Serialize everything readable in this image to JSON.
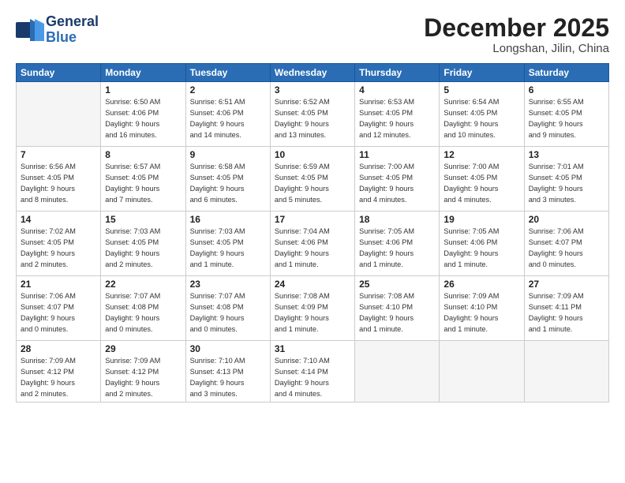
{
  "logo": {
    "line1": "General",
    "line2": "Blue"
  },
  "header": {
    "month": "December 2025",
    "location": "Longshan, Jilin, China"
  },
  "weekdays": [
    "Sunday",
    "Monday",
    "Tuesday",
    "Wednesday",
    "Thursday",
    "Friday",
    "Saturday"
  ],
  "weeks": [
    [
      {
        "day": "",
        "info": ""
      },
      {
        "day": "1",
        "info": "Sunrise: 6:50 AM\nSunset: 4:06 PM\nDaylight: 9 hours\nand 16 minutes."
      },
      {
        "day": "2",
        "info": "Sunrise: 6:51 AM\nSunset: 4:06 PM\nDaylight: 9 hours\nand 14 minutes."
      },
      {
        "day": "3",
        "info": "Sunrise: 6:52 AM\nSunset: 4:05 PM\nDaylight: 9 hours\nand 13 minutes."
      },
      {
        "day": "4",
        "info": "Sunrise: 6:53 AM\nSunset: 4:05 PM\nDaylight: 9 hours\nand 12 minutes."
      },
      {
        "day": "5",
        "info": "Sunrise: 6:54 AM\nSunset: 4:05 PM\nDaylight: 9 hours\nand 10 minutes."
      },
      {
        "day": "6",
        "info": "Sunrise: 6:55 AM\nSunset: 4:05 PM\nDaylight: 9 hours\nand 9 minutes."
      }
    ],
    [
      {
        "day": "7",
        "info": "Sunrise: 6:56 AM\nSunset: 4:05 PM\nDaylight: 9 hours\nand 8 minutes."
      },
      {
        "day": "8",
        "info": "Sunrise: 6:57 AM\nSunset: 4:05 PM\nDaylight: 9 hours\nand 7 minutes."
      },
      {
        "day": "9",
        "info": "Sunrise: 6:58 AM\nSunset: 4:05 PM\nDaylight: 9 hours\nand 6 minutes."
      },
      {
        "day": "10",
        "info": "Sunrise: 6:59 AM\nSunset: 4:05 PM\nDaylight: 9 hours\nand 5 minutes."
      },
      {
        "day": "11",
        "info": "Sunrise: 7:00 AM\nSunset: 4:05 PM\nDaylight: 9 hours\nand 4 minutes."
      },
      {
        "day": "12",
        "info": "Sunrise: 7:00 AM\nSunset: 4:05 PM\nDaylight: 9 hours\nand 4 minutes."
      },
      {
        "day": "13",
        "info": "Sunrise: 7:01 AM\nSunset: 4:05 PM\nDaylight: 9 hours\nand 3 minutes."
      }
    ],
    [
      {
        "day": "14",
        "info": "Sunrise: 7:02 AM\nSunset: 4:05 PM\nDaylight: 9 hours\nand 2 minutes."
      },
      {
        "day": "15",
        "info": "Sunrise: 7:03 AM\nSunset: 4:05 PM\nDaylight: 9 hours\nand 2 minutes."
      },
      {
        "day": "16",
        "info": "Sunrise: 7:03 AM\nSunset: 4:05 PM\nDaylight: 9 hours\nand 1 minute."
      },
      {
        "day": "17",
        "info": "Sunrise: 7:04 AM\nSunset: 4:06 PM\nDaylight: 9 hours\nand 1 minute."
      },
      {
        "day": "18",
        "info": "Sunrise: 7:05 AM\nSunset: 4:06 PM\nDaylight: 9 hours\nand 1 minute."
      },
      {
        "day": "19",
        "info": "Sunrise: 7:05 AM\nSunset: 4:06 PM\nDaylight: 9 hours\nand 1 minute."
      },
      {
        "day": "20",
        "info": "Sunrise: 7:06 AM\nSunset: 4:07 PM\nDaylight: 9 hours\nand 0 minutes."
      }
    ],
    [
      {
        "day": "21",
        "info": "Sunrise: 7:06 AM\nSunset: 4:07 PM\nDaylight: 9 hours\nand 0 minutes."
      },
      {
        "day": "22",
        "info": "Sunrise: 7:07 AM\nSunset: 4:08 PM\nDaylight: 9 hours\nand 0 minutes."
      },
      {
        "day": "23",
        "info": "Sunrise: 7:07 AM\nSunset: 4:08 PM\nDaylight: 9 hours\nand 0 minutes."
      },
      {
        "day": "24",
        "info": "Sunrise: 7:08 AM\nSunset: 4:09 PM\nDaylight: 9 hours\nand 1 minute."
      },
      {
        "day": "25",
        "info": "Sunrise: 7:08 AM\nSunset: 4:10 PM\nDaylight: 9 hours\nand 1 minute."
      },
      {
        "day": "26",
        "info": "Sunrise: 7:09 AM\nSunset: 4:10 PM\nDaylight: 9 hours\nand 1 minute."
      },
      {
        "day": "27",
        "info": "Sunrise: 7:09 AM\nSunset: 4:11 PM\nDaylight: 9 hours\nand 1 minute."
      }
    ],
    [
      {
        "day": "28",
        "info": "Sunrise: 7:09 AM\nSunset: 4:12 PM\nDaylight: 9 hours\nand 2 minutes."
      },
      {
        "day": "29",
        "info": "Sunrise: 7:09 AM\nSunset: 4:12 PM\nDaylight: 9 hours\nand 2 minutes."
      },
      {
        "day": "30",
        "info": "Sunrise: 7:10 AM\nSunset: 4:13 PM\nDaylight: 9 hours\nand 3 minutes."
      },
      {
        "day": "31",
        "info": "Sunrise: 7:10 AM\nSunset: 4:14 PM\nDaylight: 9 hours\nand 4 minutes."
      },
      {
        "day": "",
        "info": ""
      },
      {
        "day": "",
        "info": ""
      },
      {
        "day": "",
        "info": ""
      }
    ]
  ]
}
